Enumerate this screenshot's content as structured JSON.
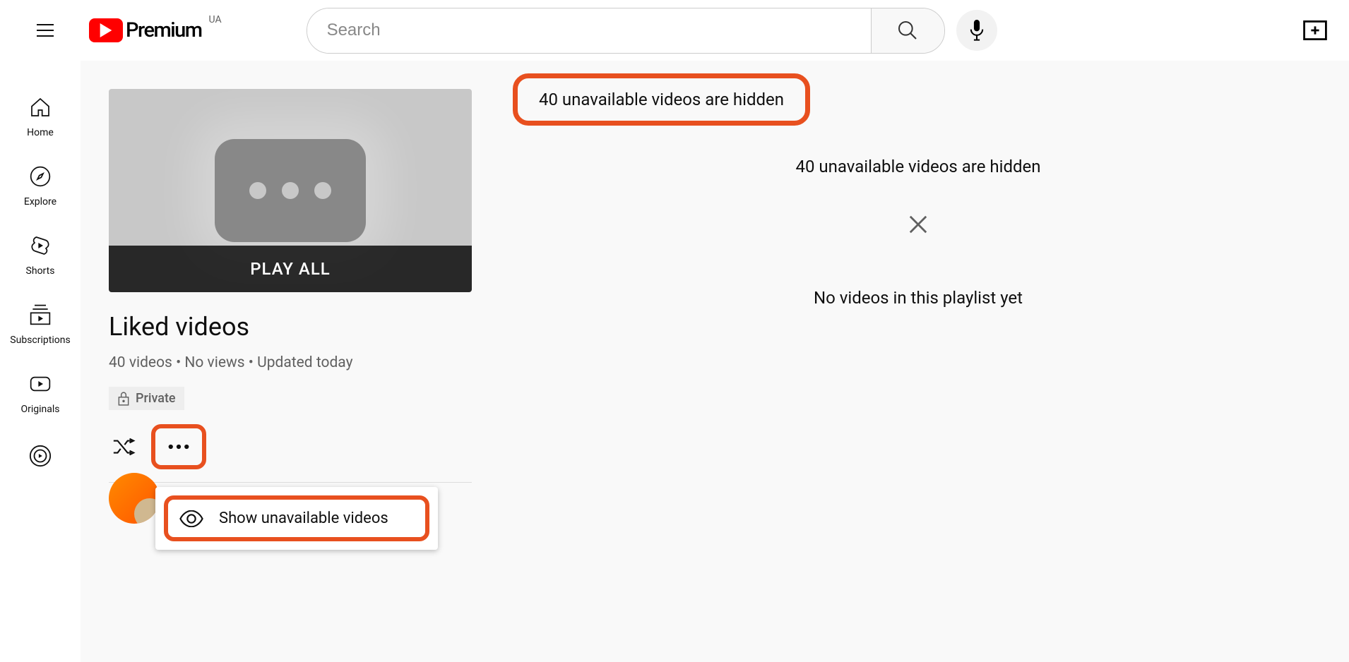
{
  "header": {
    "logo_text": "Premium",
    "logo_badge": "UA",
    "search_placeholder": "Search"
  },
  "sidebar": {
    "items": [
      {
        "label": "Home"
      },
      {
        "label": "Explore"
      },
      {
        "label": "Shorts"
      },
      {
        "label": "Subscriptions"
      },
      {
        "label": "Originals"
      }
    ]
  },
  "playlist": {
    "play_all": "PLAY ALL",
    "title": "Liked videos",
    "meta": "40 videos • No views • Updated today",
    "privacy": "Private",
    "menu_item": "Show unavailable videos"
  },
  "right": {
    "callout": "40 unavailable videos are hidden",
    "banner": "40 unavailable videos are hidden",
    "empty": "No videos in this playlist yet"
  }
}
